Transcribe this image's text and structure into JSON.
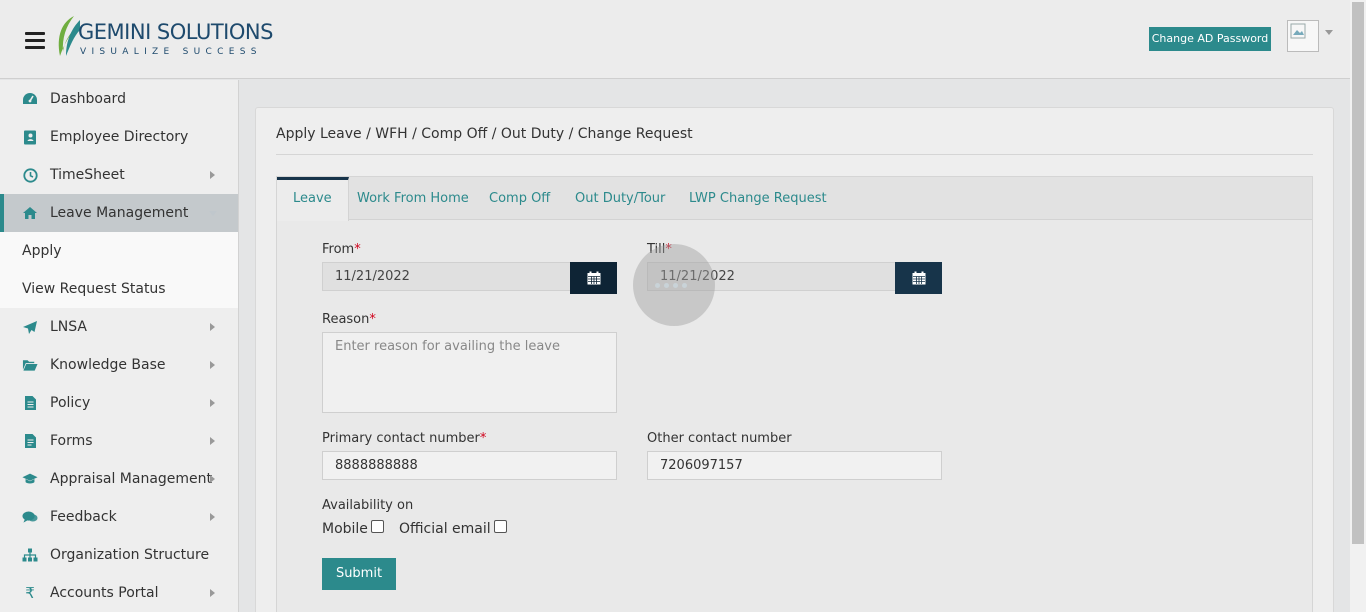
{
  "header": {
    "logo_title": "GEMINI SOLUTIONS",
    "logo_tagline": "VISUALIZE SUCCESS",
    "change_password_label": "Change AD Password"
  },
  "sidebar": {
    "items": [
      {
        "label": "Dashboard",
        "icon": "dashboard-icon"
      },
      {
        "label": "Employee Directory",
        "icon": "address-book-icon"
      },
      {
        "label": "TimeSheet",
        "icon": "clock-icon"
      },
      {
        "label": "Leave Management",
        "icon": "home-icon"
      },
      {
        "label": "Apply"
      },
      {
        "label": "View Request Status"
      },
      {
        "label": "LNSA",
        "icon": "paper-plane-icon"
      },
      {
        "label": "Knowledge Base",
        "icon": "folder-open-icon"
      },
      {
        "label": "Policy",
        "icon": "document-icon"
      },
      {
        "label": "Forms",
        "icon": "form-icon"
      },
      {
        "label": "Appraisal Management",
        "icon": "graduation-cap-icon"
      },
      {
        "label": "Feedback",
        "icon": "comments-icon"
      },
      {
        "label": "Organization Structure",
        "icon": "sitemap-icon"
      },
      {
        "label": "Accounts Portal",
        "icon": "rupee-icon"
      }
    ]
  },
  "main": {
    "title": "Apply Leave / WFH / Comp Off / Out Duty / Change Request",
    "tabs": [
      {
        "label": "Leave"
      },
      {
        "label": "Work From Home"
      },
      {
        "label": "Comp Off"
      },
      {
        "label": "Out Duty/Tour"
      },
      {
        "label": "LWP Change Request"
      }
    ],
    "form": {
      "from_label": "From",
      "from_value": "11/21/2022",
      "till_label": "Till",
      "till_value": "11/21/2022",
      "required_mark": "*",
      "reason_label": "Reason",
      "reason_placeholder": "Enter reason for availing the leave",
      "primary_contact_label": "Primary contact number",
      "primary_contact_value": "8888888888",
      "other_contact_label": "Other contact number",
      "other_contact_value": "7206097157",
      "availability_label": "Availability on",
      "mobile_label": "Mobile",
      "official_email_label": "Official email",
      "submit_label": "Submit"
    }
  },
  "colors": {
    "accent": "#2c8a8c",
    "dark_navy": "#17344a",
    "required": "#d0021b"
  }
}
